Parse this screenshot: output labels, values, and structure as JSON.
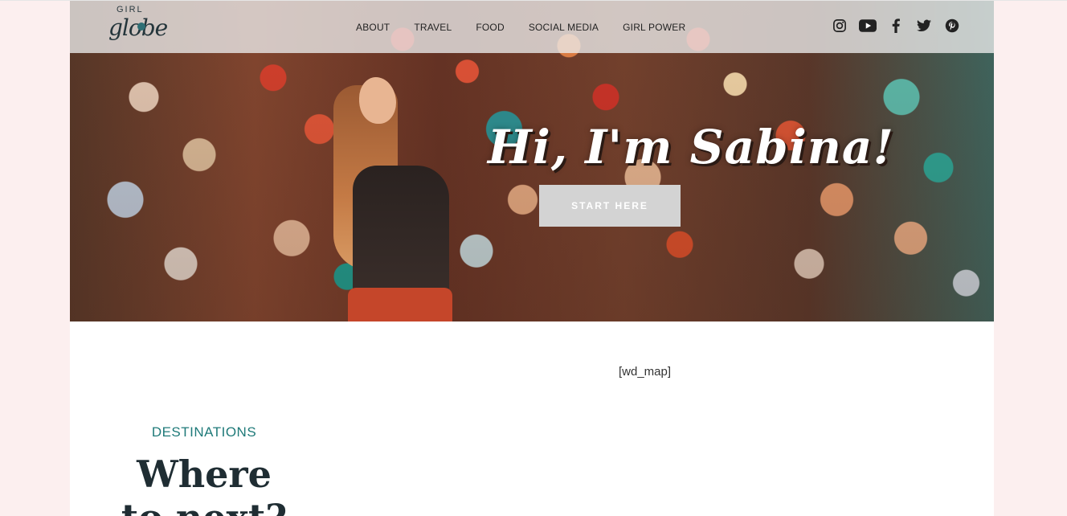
{
  "logo": {
    "top": "GIRL",
    "bottom": "globe"
  },
  "nav": {
    "items": [
      {
        "label": "ABOUT"
      },
      {
        "label": "TRAVEL"
      },
      {
        "label": "FOOD"
      },
      {
        "label": "SOCIAL MEDIA"
      },
      {
        "label": "GIRL POWER"
      }
    ]
  },
  "social": [
    {
      "icon": "instagram-icon"
    },
    {
      "icon": "youtube-icon"
    },
    {
      "icon": "facebook-icon"
    },
    {
      "icon": "twitter-icon"
    },
    {
      "icon": "pinterest-icon"
    }
  ],
  "hero": {
    "title": "Hi, I'm Sabina!",
    "cta_label": "START HERE"
  },
  "content": {
    "shortcode": "[wd_map]",
    "destinations_label": "DESTINATIONS",
    "destinations_heading": "Where to next?"
  },
  "colors": {
    "page_background": "#fcefef",
    "accent_teal": "#1f7a79",
    "heading_dark": "#1f2d33",
    "cta_background": "#d3d3d3"
  }
}
